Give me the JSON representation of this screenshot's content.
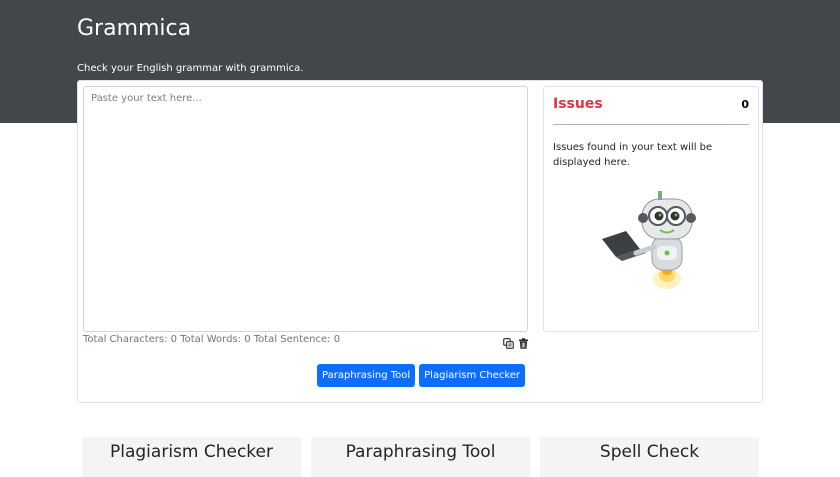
{
  "header": {
    "brand": "Grammica",
    "tagline": "Check your English grammar with grammica."
  },
  "editor": {
    "placeholder": "Paste your text here...",
    "value": ""
  },
  "stats": {
    "text": "Total Characters: 0 Total Words: 0 Total Sentence: 0"
  },
  "toolbar": {
    "copy_icon": "copy-icon",
    "delete_icon": "trash-icon"
  },
  "buttons": {
    "paraphrasing": "Paraphrasing Tool",
    "plagiarism": "Plagiarism Checker"
  },
  "issues": {
    "title": "Issues",
    "count": "0",
    "message": "Issues found in your text will be displayed here."
  },
  "tiles": [
    {
      "label": "Plagiarism Checker"
    },
    {
      "label": "Paraphrasing Tool"
    },
    {
      "label": "Spell Check"
    }
  ],
  "colors": {
    "hero_bg": "#43474b",
    "primary": "#0d6efd",
    "issues_title": "#dc3545"
  }
}
